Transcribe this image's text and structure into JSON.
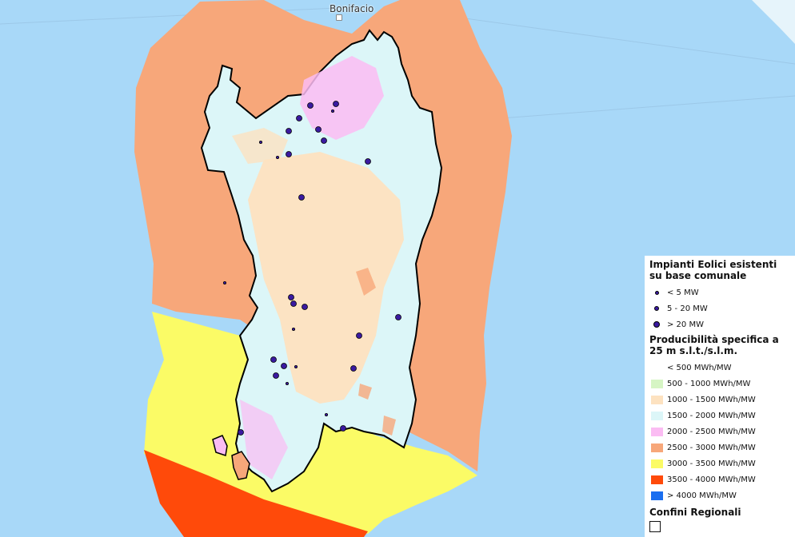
{
  "map": {
    "place_label": "Bonifacio",
    "colors": {
      "sea": "#a8d8f8",
      "band_2500_3000": "#f7a77a",
      "band_3000_3500": "#fbfb66",
      "band_3500_4000": "#ff4a0a",
      "land_1000_1500": "#fde2c0",
      "land_1500_2000": "#dcf6f8",
      "land_2000_2500": "#fbbcf3"
    }
  },
  "legend": {
    "section1_title": "Impianti Eolici esistenti su base comunale",
    "plants": [
      {
        "label": "< 5 MW",
        "size": "small"
      },
      {
        "label": "5 - 20 MW",
        "size": "medium"
      },
      {
        "label": "> 20 MW",
        "size": "large"
      }
    ],
    "section2_title": "Producibilità specifica a 25 m s.l.t./s.l.m.",
    "classes": [
      {
        "label": "< 500 MWh/MW",
        "color": "#ffffff"
      },
      {
        "label": "500 - 1000 MWh/MW",
        "color": "#d6f5c4"
      },
      {
        "label": "1000 - 1500 MWh/MW",
        "color": "#fde2c0"
      },
      {
        "label": "1500 - 2000 MWh/MW",
        "color": "#dcf6f8"
      },
      {
        "label": "2000 - 2500 MWh/MW",
        "color": "#fbbcf3"
      },
      {
        "label": "2500 - 3000 MWh/MW",
        "color": "#f7a77a"
      },
      {
        "label": "3000 - 3500 MWh/MW",
        "color": "#fbfb66"
      },
      {
        "label": "3500 - 4000 MWh/MW",
        "color": "#ff4a0a"
      },
      {
        "label": "> 4000 MWh/MW",
        "color": "#1a6ef0"
      }
    ],
    "section3_title": "Confini Regionali"
  }
}
